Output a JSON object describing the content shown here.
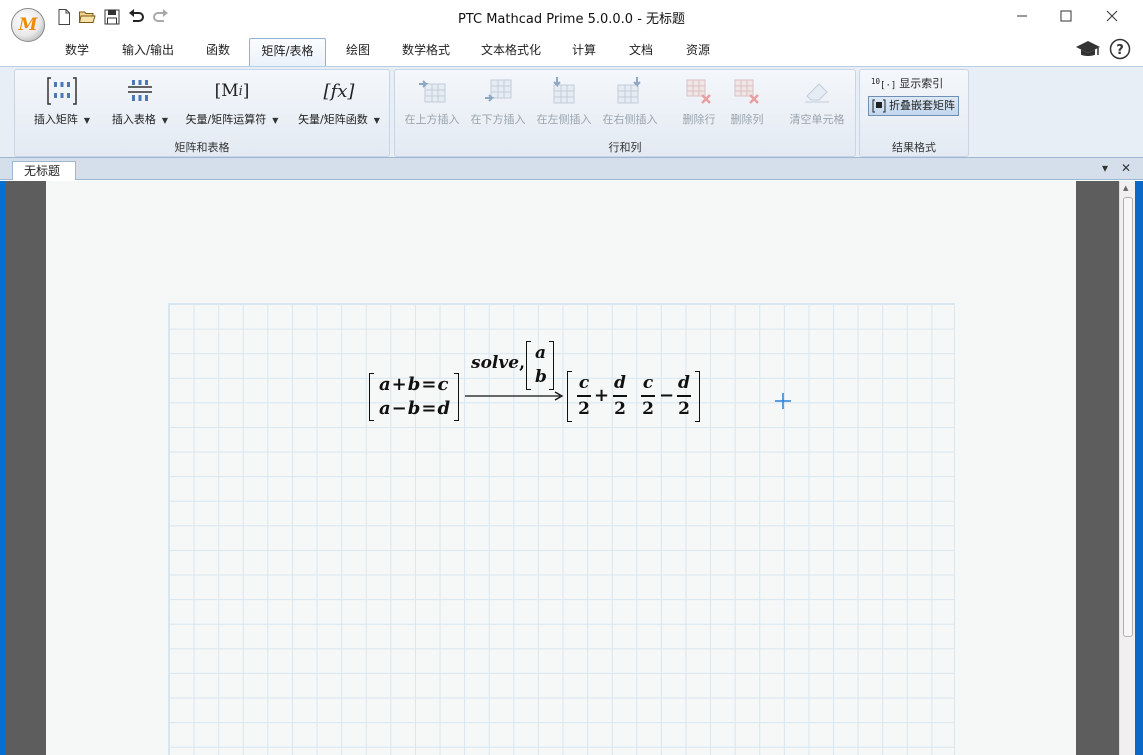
{
  "window": {
    "title": "PTC Mathcad Prime 5.0.0.0 - 无标题",
    "app_logo_letter": "M"
  },
  "quick_access": [
    "new-document-icon",
    "open-folder-icon",
    "save-icon",
    "undo-icon",
    "redo-icon"
  ],
  "tabs": [
    {
      "label": "数学"
    },
    {
      "label": "输入/输出"
    },
    {
      "label": "函数"
    },
    {
      "label": "矩阵/表格",
      "active": true
    },
    {
      "label": "绘图"
    },
    {
      "label": "数学格式"
    },
    {
      "label": "文本格式化"
    },
    {
      "label": "计算"
    },
    {
      "label": "文档"
    },
    {
      "label": "资源"
    }
  ],
  "ribbon": {
    "group1": {
      "title": "矩阵和表格",
      "buttons": [
        {
          "label": "插入矩阵"
        },
        {
          "label": "插入表格"
        },
        {
          "label": "矢量/矩阵运算符",
          "glyph": "M",
          "sub": "i"
        },
        {
          "label": "矢量/矩阵函数",
          "glyph": "fx"
        }
      ]
    },
    "group2": {
      "title": "行和列",
      "buttons": [
        {
          "label": "在上方插入"
        },
        {
          "label": "在下方插入"
        },
        {
          "label": "在左侧插入"
        },
        {
          "label": "在右侧插入"
        },
        {
          "label": "删除行"
        },
        {
          "label": "删除列"
        },
        {
          "label": "清空单元格"
        }
      ]
    },
    "group3": {
      "title": "结果格式",
      "show_index": "显示索引",
      "collapse_nested": "折叠嵌套矩阵",
      "index_glyph": "10"
    }
  },
  "document_tab": {
    "label": "无标题"
  },
  "worksheet": {
    "eq_row1": [
      "a",
      "+",
      "b",
      "=",
      "c"
    ],
    "eq_row2": [
      "a",
      "−",
      "b",
      "=",
      "d"
    ],
    "keyword": "solve",
    "comma": ",",
    "vars": [
      "a",
      "b"
    ],
    "result": [
      {
        "num": "c",
        "den": "2"
      },
      {
        "op": "+"
      },
      {
        "num": "d",
        "den": "2"
      },
      {
        "num": "c",
        "den": "2"
      },
      {
        "op": "−"
      },
      {
        "num": "d",
        "den": "2"
      }
    ]
  }
}
